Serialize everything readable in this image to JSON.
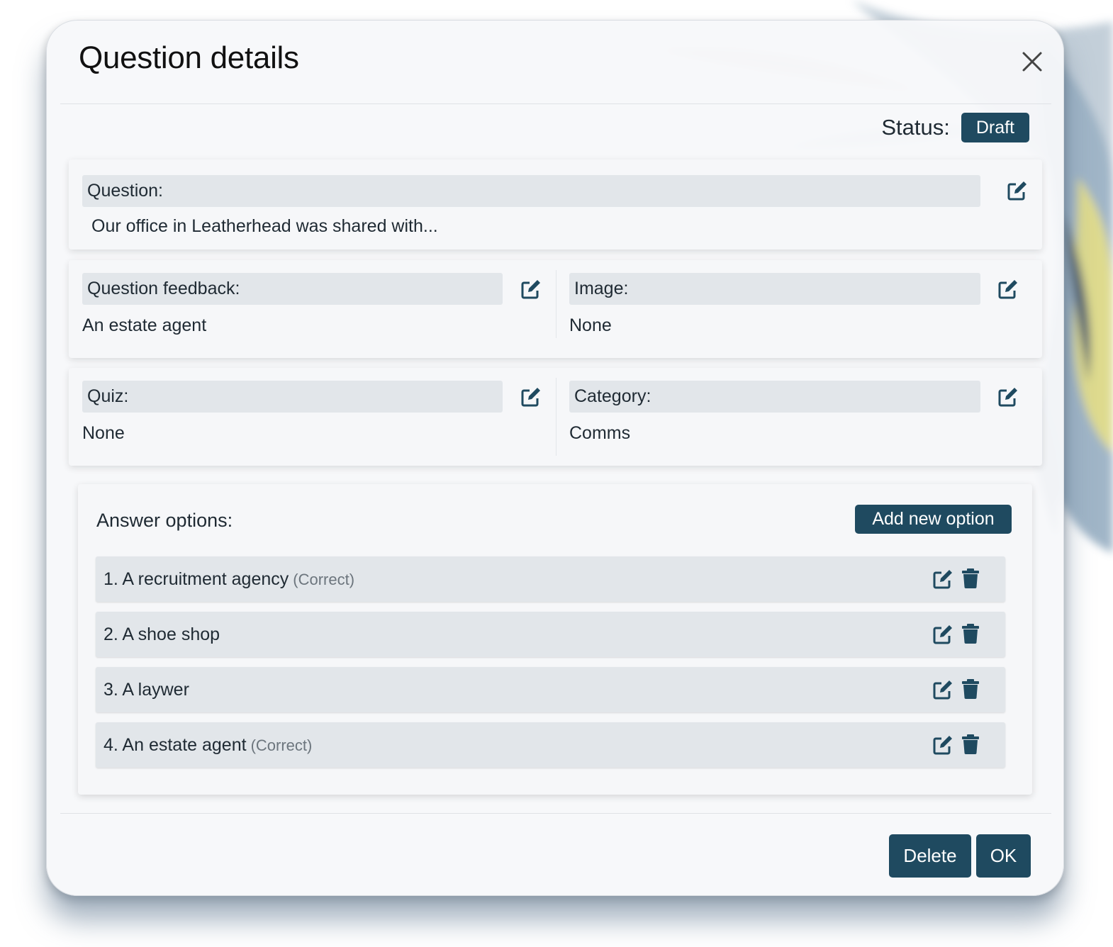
{
  "modal": {
    "title": "Question details",
    "status_label": "Status:",
    "status_value": "Draft"
  },
  "question": {
    "label": "Question:",
    "value": "Our office in Leatherhead was shared with..."
  },
  "feedback": {
    "label": "Question feedback:",
    "value": "An estate agent"
  },
  "image": {
    "label": "Image:",
    "value": "None"
  },
  "quiz": {
    "label": "Quiz:",
    "value": "None"
  },
  "category": {
    "label": "Category:",
    "value": "Comms"
  },
  "answers": {
    "title": "Answer options:",
    "add_label": "Add new option",
    "options": [
      {
        "text": "1. A recruitment agency",
        "tag": "(Correct)"
      },
      {
        "text": "2. A shoe shop",
        "tag": ""
      },
      {
        "text": "3. A laywer",
        "tag": ""
      },
      {
        "text": "4. An estate agent",
        "tag": "(Correct)"
      }
    ]
  },
  "footer": {
    "delete_label": "Delete",
    "ok_label": "OK"
  },
  "colors": {
    "primary": "#1f4a60",
    "label_bg": "#e2e6ea",
    "modal_bg": "#f7f8fa"
  },
  "icons": {
    "close": "close-icon",
    "edit": "edit-icon",
    "delete": "trash-icon"
  }
}
